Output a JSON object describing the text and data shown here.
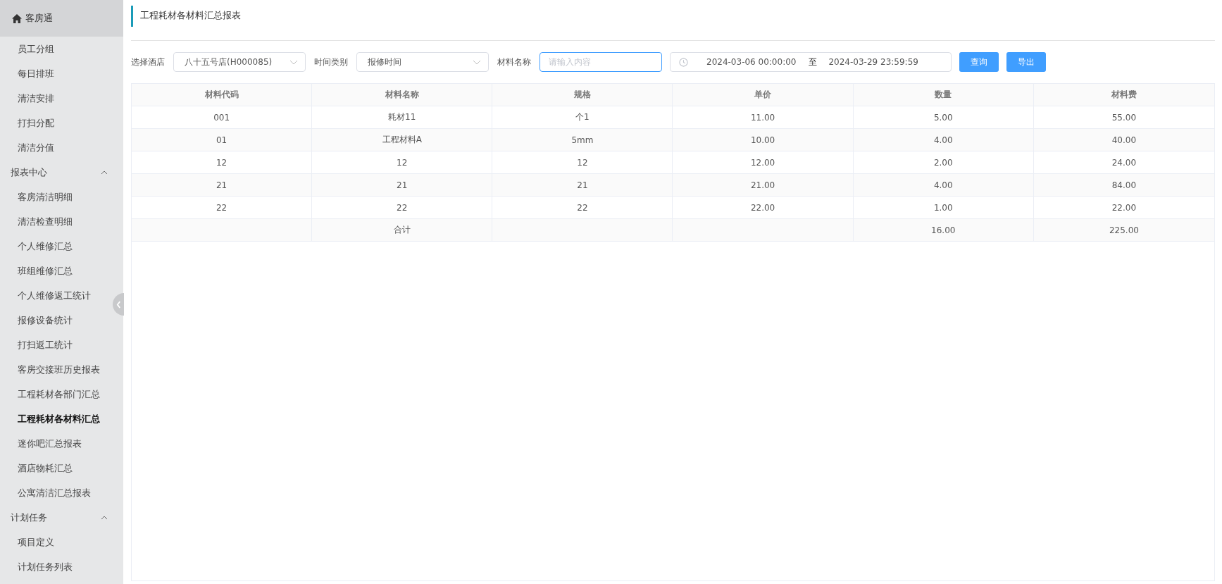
{
  "sidebar": {
    "brand": "客房通",
    "items": [
      {
        "kind": "item",
        "label": "员工分组",
        "selected": false
      },
      {
        "kind": "item",
        "label": "每日排班",
        "selected": false
      },
      {
        "kind": "item",
        "label": "清洁安排",
        "selected": false
      },
      {
        "kind": "item",
        "label": "打扫分配",
        "selected": false
      },
      {
        "kind": "item",
        "label": "清洁分值",
        "selected": false
      },
      {
        "kind": "group",
        "label": "报表中心",
        "expanded": true,
        "children": [
          {
            "label": "客房清洁明细",
            "selected": false
          },
          {
            "label": "清洁检查明细",
            "selected": false
          },
          {
            "label": "个人维修汇总",
            "selected": false
          },
          {
            "label": "班组维修汇总",
            "selected": false
          },
          {
            "label": "个人维修返工统计",
            "selected": false
          },
          {
            "label": "报修设备统计",
            "selected": false
          },
          {
            "label": "打扫返工统计",
            "selected": false
          },
          {
            "label": "客房交接班历史报表",
            "selected": false
          },
          {
            "label": "工程耗材各部门汇总",
            "selected": false
          },
          {
            "label": "工程耗材各材料汇总",
            "selected": true
          },
          {
            "label": "迷你吧汇总报表",
            "selected": false
          },
          {
            "label": "酒店物耗汇总",
            "selected": false
          },
          {
            "label": "公寓清洁汇总报表",
            "selected": false
          }
        ]
      },
      {
        "kind": "group",
        "label": "计划任务",
        "expanded": true,
        "children": [
          {
            "label": "项目定义",
            "selected": false
          },
          {
            "label": "计划任务列表",
            "selected": false
          }
        ]
      }
    ]
  },
  "page_title": "工程耗材各材料汇总报表",
  "filters": {
    "hotel_label": "选择酒店",
    "hotel_value": "八十五号店(H000085)",
    "time_type_label": "时间类别",
    "time_type_value": "报修时间",
    "material_label": "材料名称",
    "material_placeholder": "请输入内容",
    "date_start": "2024-03-06 00:00:00",
    "date_separator": "至",
    "date_end": "2024-03-29 23:59:59",
    "buttons": [
      "查询",
      "导出"
    ]
  },
  "table": {
    "columns": [
      "材料代码",
      "材料名称",
      "规格",
      "单价",
      "数量",
      "材料费"
    ],
    "rows": [
      [
        "001",
        "耗材11",
        "个1",
        "11.00",
        "5.00",
        "55.00"
      ],
      [
        "01",
        "工程材料A",
        "5mm",
        "10.00",
        "4.00",
        "40.00"
      ],
      [
        "12",
        "12",
        "12",
        "12.00",
        "2.00",
        "24.00"
      ],
      [
        "21",
        "21",
        "21",
        "21.00",
        "4.00",
        "84.00"
      ],
      [
        "22",
        "22",
        "22",
        "22.00",
        "1.00",
        "22.00"
      ]
    ],
    "total_row": {
      "label": "合计",
      "quantity": "16.00",
      "amount": "225.00"
    }
  }
}
